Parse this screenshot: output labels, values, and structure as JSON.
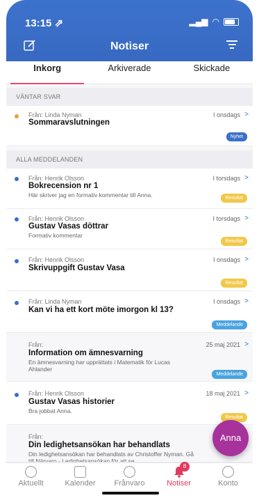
{
  "status": {
    "time": "13:15 ⇗"
  },
  "header": {
    "title": "Notiser",
    "compose_icon": "compose-icon",
    "filter_icon": "filter-icon"
  },
  "tabs": [
    {
      "label": "Inkorg",
      "active": true
    },
    {
      "label": "Arkiverade",
      "active": false
    },
    {
      "label": "Skickade",
      "active": false
    }
  ],
  "sections": {
    "waiting": "VÄNTAR SVAR",
    "all": "ALLA MEDDELANDEN"
  },
  "messages": [
    {
      "from": "Från: Linda Nyman",
      "date": "I onsdags",
      "subject": "Sommaravslutningen",
      "preview": "",
      "badge": "Nyhet",
      "dot": "#e8a13a"
    },
    {
      "from": "Från: Henrik Olsson",
      "date": "I torsdags",
      "subject": "Bokrecension nr 1",
      "preview": "Här skriver jag en formativ kommentar till Anna.",
      "badge": "Resultat",
      "dot": "#3b6fc9"
    },
    {
      "from": "Från: Henrik Olsson",
      "date": "I torsdags",
      "subject": "Gustav Vasas döttrar",
      "preview": "Formativ kommentar",
      "badge": "Resultat",
      "dot": "#3b6fc9"
    },
    {
      "from": "Från: Henrik Olsson",
      "date": "I onsdags",
      "subject": "Skrivuppgift Gustav Vasa",
      "preview": "",
      "badge": "Resultat",
      "dot": "#3b6fc9"
    },
    {
      "from": "Från: Linda Nyman",
      "date": "I onsdags",
      "subject": "Kan vi ha ett kort möte imorgon kl 13?",
      "preview": "",
      "badge": "Meddelande",
      "dot": "#3b6fc9"
    },
    {
      "from": "Från:",
      "date": "25 maj 2021",
      "subject": "Information om ämnesvarning",
      "preview": "En ämnesvarning har upprättats i Matematik för Lucas Ahlander",
      "badge": "Meddelande",
      "dot": ""
    },
    {
      "from": "Från: Henrik Olsson",
      "date": "18 maj 2021",
      "subject": "Gustav Vasas historier",
      "preview": "Bra jobbat Anna.",
      "badge": "Resultat",
      "dot": "#3b6fc9"
    },
    {
      "from": "Från:",
      "date": "",
      "subject": "Din ledighetsansökan har behandlats",
      "preview": "Din ledighetsansökan har behandlats av Christoffer Nyman. Gå till Närvaro - Ledighetsansökan för att se",
      "badge": "",
      "dot": ""
    }
  ],
  "badge_colors": {
    "Nyhet": "#3b6fc9",
    "Resultat": "#f2c84b",
    "Meddelande": "#4aa3df"
  },
  "fab": {
    "label": "Anna"
  },
  "tabbar": [
    {
      "label": "Aktuellt",
      "icon": "clock-icon",
      "active": false
    },
    {
      "label": "Kalender",
      "icon": "calendar-icon",
      "active": false
    },
    {
      "label": "Frånvaro",
      "icon": "absence-icon",
      "active": false
    },
    {
      "label": "Notiser",
      "icon": "bell-icon",
      "active": true,
      "count": "8"
    },
    {
      "label": "Konto",
      "icon": "account-icon",
      "active": false
    }
  ]
}
